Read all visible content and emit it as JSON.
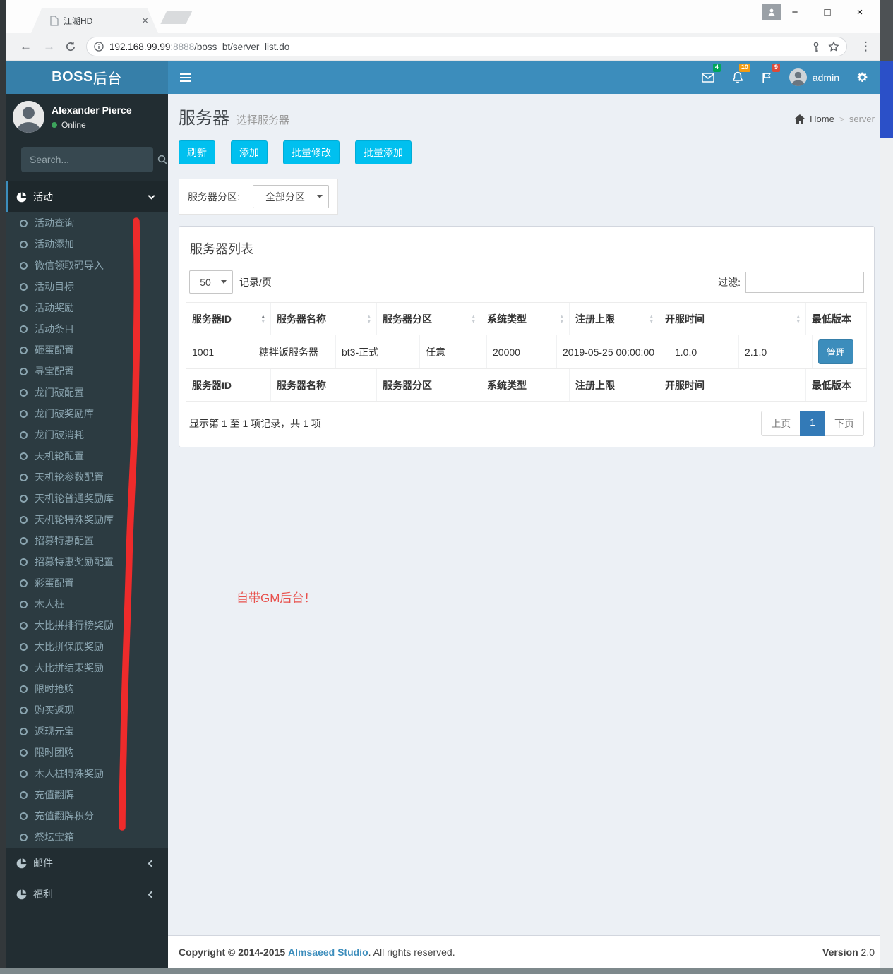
{
  "browser": {
    "tab_title": "江湖HD",
    "url_host": "192.168.99.99",
    "url_port": ":8888",
    "url_path": "/boss_bt/server_list.do"
  },
  "navbar": {
    "logo_bold": "BOSS",
    "logo_suffix": "后台",
    "badges": {
      "messages": "4",
      "notifications": "10",
      "flags": "9"
    },
    "username": "admin"
  },
  "sidebar": {
    "user": {
      "name": "Alexander Pierce",
      "status": "Online"
    },
    "search_placeholder": "Search...",
    "sections": [
      {
        "label": "活动"
      },
      {
        "label": "邮件"
      },
      {
        "label": "福利"
      }
    ],
    "activity_items": [
      "活动查询",
      "活动添加",
      "微信领取码导入",
      "活动目标",
      "活动奖励",
      "活动条目",
      "砸蛋配置",
      "寻宝配置",
      "龙门破配置",
      "龙门破奖励库",
      "龙门破消耗",
      "天机轮配置",
      "天机轮参数配置",
      "天机轮普通奖励库",
      "天机轮特殊奖励库",
      "招募特惠配置",
      "招募特惠奖励配置",
      "彩蛋配置",
      "木人桩",
      "大比拼排行榜奖励",
      "大比拼保底奖励",
      "大比拼结束奖励",
      "限时抢购",
      "购买返现",
      "返现元宝",
      "限时团购",
      "木人桩特殊奖励",
      "充值翻牌",
      "充值翻牌积分",
      "祭坛宝箱"
    ]
  },
  "content": {
    "title": "服务器",
    "subtitle": "选择服务器",
    "breadcrumb": {
      "home": "Home",
      "current": "server"
    },
    "toolbar_buttons": [
      "刷新",
      "添加",
      "批量修改",
      "批量添加"
    ],
    "partition": {
      "label": "服务器分区:",
      "value": "全部分区"
    },
    "box": {
      "title": "服务器列表",
      "page_size": "50",
      "page_size_suffix": "记录/页",
      "filter_label": "过滤:",
      "filter_value": "",
      "table": {
        "headers": [
          "服务器ID",
          "服务器名称",
          "服务器分区",
          "系统类型",
          "注册上限",
          "开服时间",
          "最低版本"
        ],
        "row_cells": [
          "1001",
          "糖拌饭服务器",
          "bt3-正式",
          "任意",
          "20000",
          "2019-05-25 00:00:00",
          "1.0.0",
          "2.1.0"
        ],
        "row_action": "管理"
      },
      "pagination": {
        "info": "显示第 1 至 1 项记录，共 1 项",
        "prev": "上页",
        "page": "1",
        "next": "下页"
      }
    }
  },
  "annotation": {
    "text": "自带GM后台！"
  },
  "footer": {
    "copyright_bold": "Copyright © 2014-2015",
    "link": "Almsaeed Studio",
    "copyright_rest": ". All rights reserved.",
    "version_label": "Version",
    "version_value": "2.0"
  },
  "colors": {
    "navbar": "#3c8dbc",
    "logo_bg": "#367fa9",
    "sidebar_bg": "#222d32",
    "submenu_bg": "#2c3b41",
    "active_item_bg": "#1e282c",
    "content_bg": "#ecf0f5",
    "info_btn": "#00c0ef",
    "primary": "#3c8dbc",
    "badge_green": "#00a65a",
    "badge_yellow": "#f39c12",
    "badge_red": "#dd4b39",
    "active_page": "#337ab7",
    "annotation_red": "#e8504c",
    "line_red": "#ee2b2b",
    "desktop_blue": "#2b50c8"
  }
}
